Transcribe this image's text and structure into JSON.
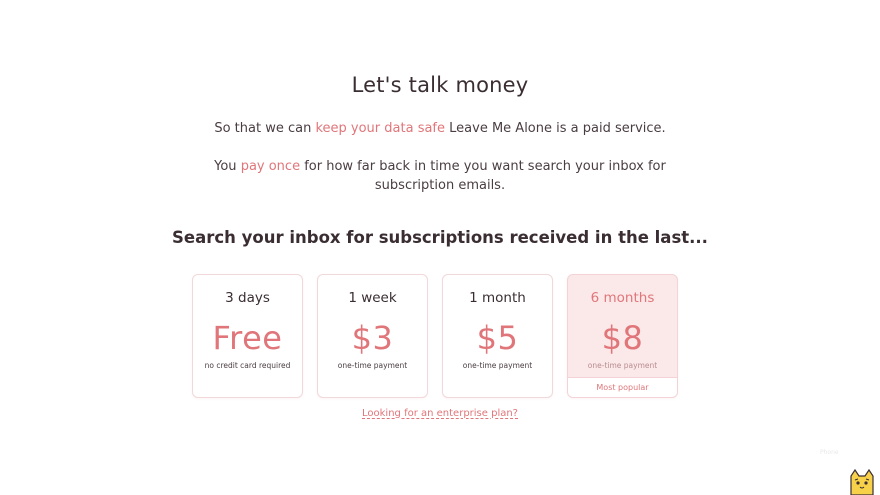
{
  "heading": "Let's talk money",
  "intro": {
    "line1_before": "So that we can ",
    "line1_link": "keep your data safe",
    "line1_after": " Leave Me Alone is a paid service.",
    "line2_before": "You ",
    "line2_link": "pay once",
    "line2_after": " for how far back in time you want search your inbox for",
    "line3": "subscription emails."
  },
  "subtitle": "Search your inbox for subscriptions received in the last...",
  "plans": [
    {
      "period": "3 days",
      "price": "Free",
      "note": "no credit card required"
    },
    {
      "period": "1 week",
      "price": "$3",
      "note": "one-time payment"
    },
    {
      "period": "1 month",
      "price": "$5",
      "note": "one-time payment"
    },
    {
      "period": "6 months",
      "price": "$8",
      "note": "one-time payment",
      "badge": "Most popular",
      "selected": true
    }
  ],
  "enterprise_link": "Looking for an enterprise plan?",
  "faint_text": "Phone",
  "chat_icon": "cat-mascot-icon",
  "colors": {
    "accent": "#e0767a",
    "selected_bg": "#fbe8e9",
    "card_border": "#f1d8da"
  }
}
